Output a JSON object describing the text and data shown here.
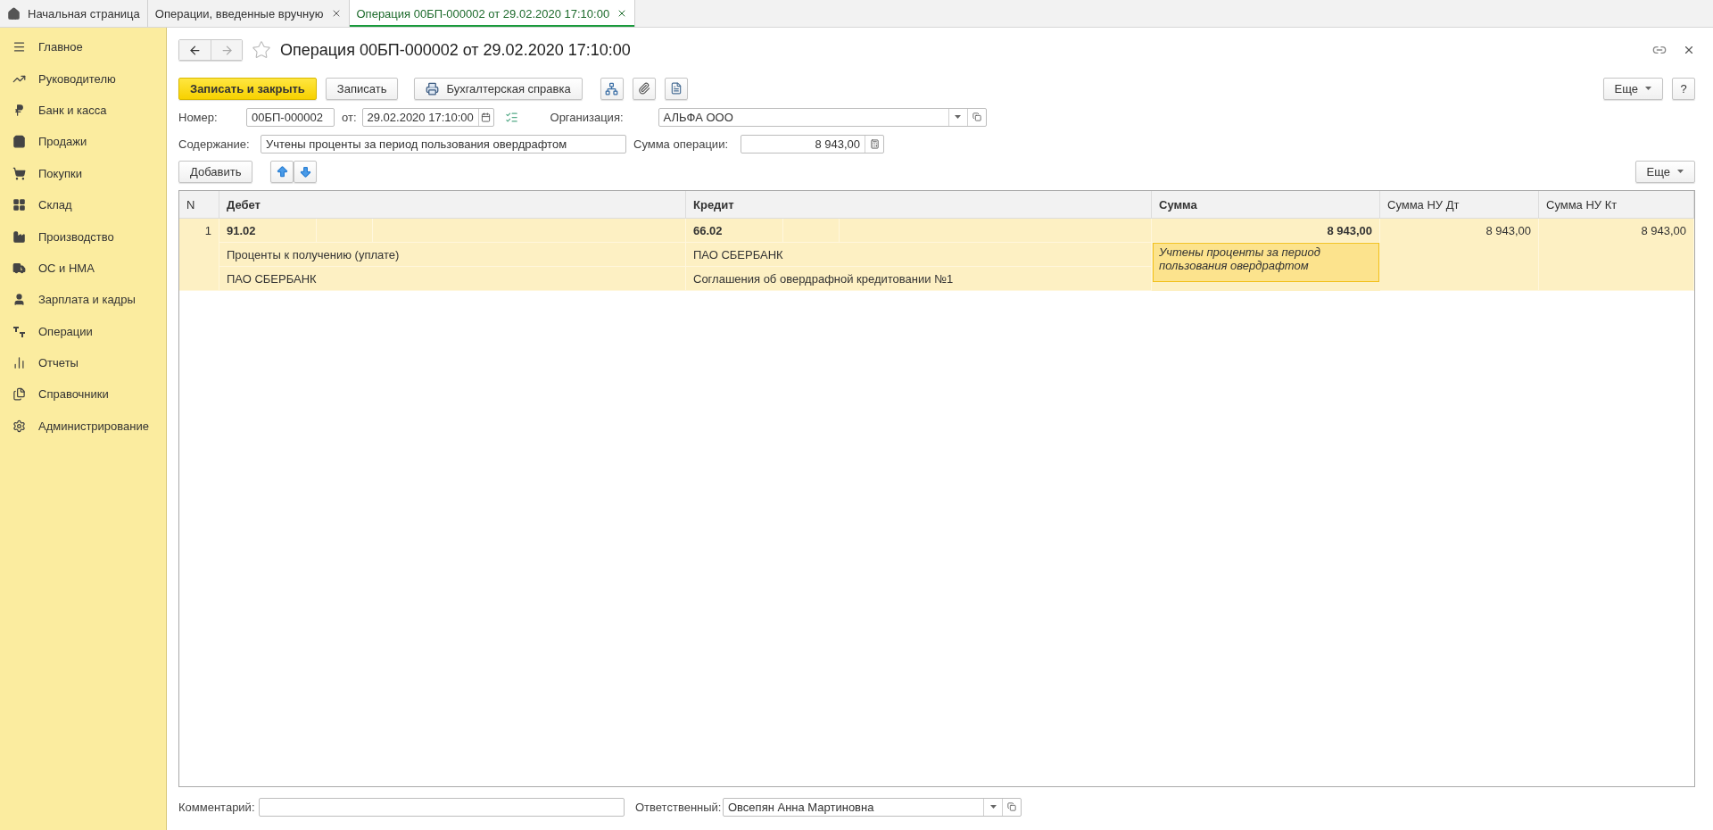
{
  "tabs": [
    {
      "label": "Начальная страница",
      "selected": false
    },
    {
      "label": "Операции, введенные вручную",
      "selected": false
    },
    {
      "label": "Операция 00БП-000002 от 29.02.2020 17:10:00",
      "selected": true
    }
  ],
  "sidebar": {
    "items": [
      {
        "label": "Главное"
      },
      {
        "label": "Руководителю"
      },
      {
        "label": "Банк и касса"
      },
      {
        "label": "Продажи"
      },
      {
        "label": "Покупки"
      },
      {
        "label": "Склад"
      },
      {
        "label": "Производство"
      },
      {
        "label": "ОС и НМА"
      },
      {
        "label": "Зарплата и кадры"
      },
      {
        "label": "Операции"
      },
      {
        "label": "Отчеты"
      },
      {
        "label": "Справочники"
      },
      {
        "label": "Администрирование"
      }
    ]
  },
  "document": {
    "title": "Операция 00БП-000002 от 29.02.2020 17:10:00",
    "favorite": false
  },
  "toolbar": {
    "primary": "Записать и закрыть",
    "save": "Записать",
    "report": "Бухгалтерская справка",
    "more": "Еще",
    "help": "?"
  },
  "fields": {
    "number_label": "Номер:",
    "number": "00БП-000002",
    "date_label": "от:",
    "date": "29.02.2020 17:10:00",
    "org_label": "Организация:",
    "org": "АЛЬФА ООО",
    "content_label": "Содержание:",
    "content": "Учтены проценты за период пользования овердрафтом",
    "sum_label": "Сумма операции:",
    "sum": "8 943,00"
  },
  "table_toolbar": {
    "add": "Добавить",
    "more": "Еще"
  },
  "table": {
    "columns": [
      {
        "label": "N",
        "bold": false
      },
      {
        "label": "Дебет",
        "bold": true
      },
      {
        "label": "Кредит",
        "bold": true
      },
      {
        "label": "Сумма",
        "bold": true
      },
      {
        "label": "Сумма НУ Дт",
        "bold": false
      },
      {
        "label": "Сумма НУ Кт",
        "bold": false
      }
    ],
    "rows": [
      {
        "n": "1",
        "selected": true,
        "debit": {
          "account": "91.02",
          "lines": [
            "Проценты к получению (уплате)",
            "ПАО СБЕРБАНК"
          ]
        },
        "credit": {
          "account": "66.02",
          "lines": [
            "ПАО СБЕРБАНК",
            "Соглашения об овердрафной кредитовании №1"
          ]
        },
        "sum": "8 943,00",
        "content": "Учтены проценты за период пользования овердрафтом",
        "sum_nu_dt": "8 943,00",
        "sum_nu_kt": "8 943,00"
      }
    ]
  },
  "footer": {
    "comment_label": "Комментарий:",
    "responsible_label": "Ответственный:",
    "responsible": "Овсепян Анна Мартиновна"
  }
}
